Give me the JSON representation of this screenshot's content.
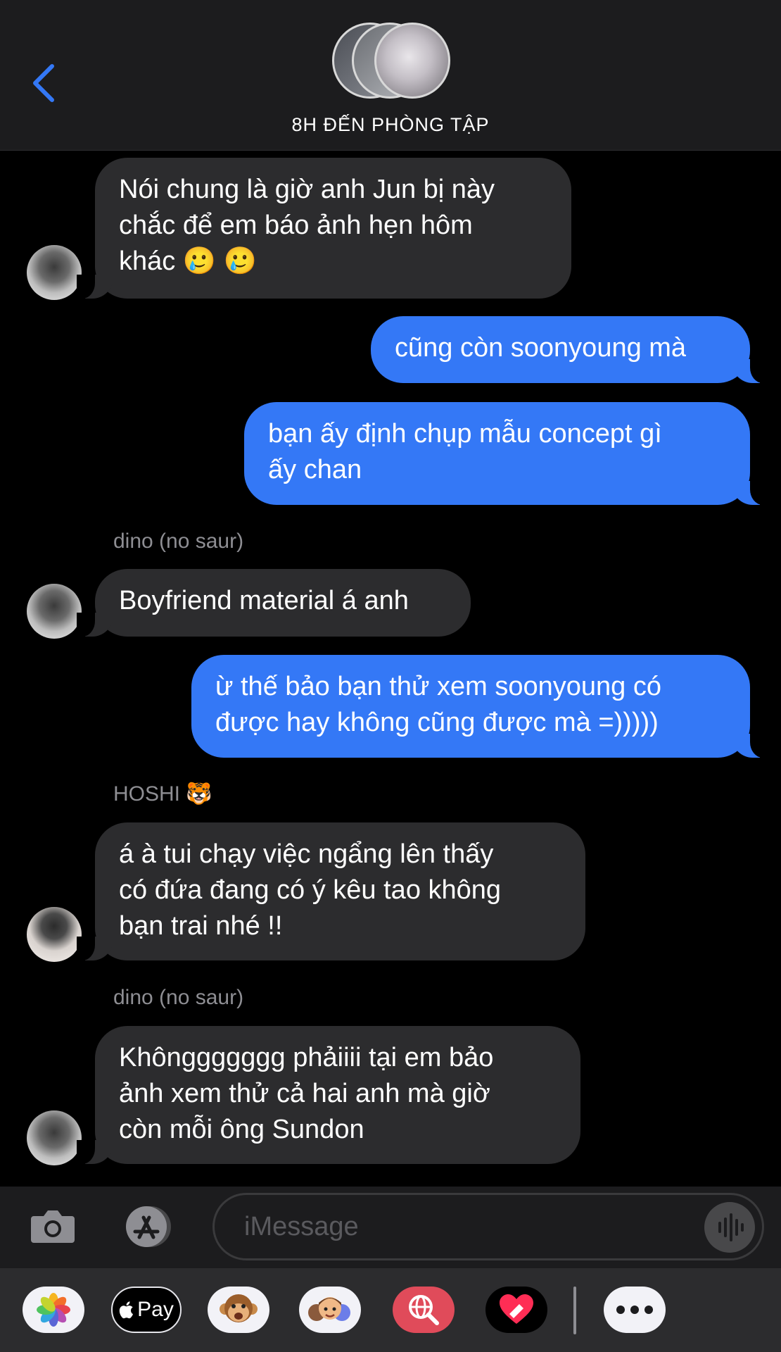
{
  "header": {
    "title": "8H ĐẾN PHÒNG TẬP"
  },
  "messages": [
    {
      "from": "in",
      "text_lines": [
        "Nói chung là giờ anh Jun bị này",
        "chắc để em báo ảnh hẹn hôm",
        "khác 🥲 🥲"
      ]
    },
    {
      "from": "out",
      "text_lines": [
        "cũng còn soonyoung mà"
      ]
    },
    {
      "from": "out",
      "text_lines": [
        "bạn ấy định chụp mẫu concept gì",
        "ấy chan"
      ]
    },
    {
      "from": "in",
      "sender": "dino (no saur)",
      "text_lines": [
        "Boyfriend material á anh"
      ]
    },
    {
      "from": "out",
      "text_lines": [
        "ừ thế bảo bạn thử xem soonyoung có",
        "được hay không cũng được mà =)))))"
      ]
    },
    {
      "from": "in",
      "sender": "HOSHI 🐯",
      "text_lines": [
        "á à tui chạy việc ngẩng lên thấy",
        "có đứa đang có ý kêu tao không",
        "bạn trai nhé !!"
      ]
    },
    {
      "from": "in",
      "sender": "dino (no saur)",
      "text_lines": [
        "Khônggggggg phảiiii tại em bảo",
        "ảnh xem thử cả hai anh mà giờ",
        "còn mỗi ông Sundon"
      ]
    }
  ],
  "input": {
    "placeholder": "iMessage"
  },
  "drawer": {
    "apple_pay_label": "Pay"
  },
  "colors": {
    "incoming_bubble": "#2c2c2e",
    "outgoing_bubble": "#3478f6",
    "accent": "#3478f6"
  }
}
